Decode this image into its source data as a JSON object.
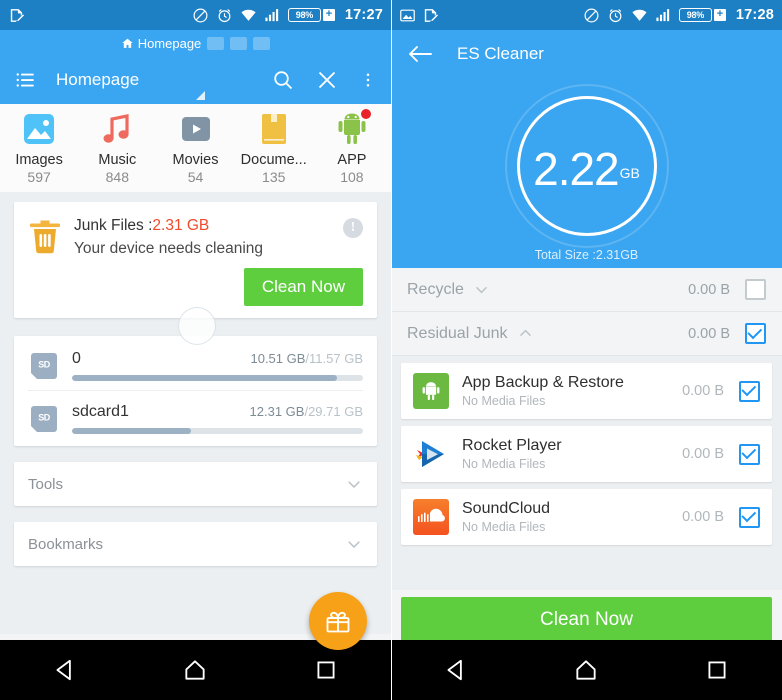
{
  "left": {
    "statusbar": {
      "icons": [
        "note-edit-icon",
        "no-disturb-icon",
        "alarm-icon",
        "wifi-icon",
        "signal-icon"
      ],
      "battery": "98%",
      "charging_symbol": "+",
      "time": "17:27"
    },
    "tabstrip": {
      "active_tab": "Homepage",
      "ghost_tabs": 3,
      "home_icon": "home-icon"
    },
    "appbar": {
      "menu_icon": "list-menu-icon",
      "title": "Homepage",
      "search_icon": "search-icon",
      "close_icon": "close-icon",
      "overflow_icon": "overflow-menu-icon"
    },
    "categories": [
      {
        "name": "Images",
        "count": "597",
        "icon": "image-icon",
        "color": "#4fc3f7"
      },
      {
        "name": "Music",
        "count": "848",
        "icon": "music-icon",
        "color": "#ef6a5e"
      },
      {
        "name": "Movies",
        "count": "54",
        "icon": "movie-icon",
        "color": "#8194a6"
      },
      {
        "name": "Docume...",
        "count": "135",
        "icon": "document-icon",
        "color": "#f0c042"
      },
      {
        "name": "APP",
        "count": "108",
        "icon": "android-icon",
        "color": "#8bc34a",
        "badge": true
      }
    ],
    "junk_card": {
      "icon": "trash-icon",
      "label": "Junk Files :",
      "size": "2.31 GB",
      "subtitle": "Your device needs cleaning",
      "info_icon": "info-icon",
      "button": "Clean Now",
      "button_color": "#5ece3f"
    },
    "storage": [
      {
        "icon": "sd-card-icon",
        "name": "0",
        "used": "10.51 GB",
        "total": "/11.57 GB",
        "percent": 91
      },
      {
        "icon": "sd-card-icon",
        "name": "sdcard1",
        "used": "12.31 GB",
        "total": "/29.71 GB",
        "percent": 41
      }
    ],
    "rows": [
      {
        "label": "Tools",
        "chevron": "chevron-down-icon"
      },
      {
        "label": "Bookmarks",
        "chevron": "chevron-down-icon"
      }
    ],
    "fab": {
      "icon": "gift-icon",
      "color": "#f6a117"
    }
  },
  "right": {
    "statusbar": {
      "icons": [
        "gallery-icon",
        "note-edit-icon",
        "no-disturb-icon",
        "alarm-icon",
        "wifi-icon",
        "signal-icon"
      ],
      "battery": "98%",
      "charging_symbol": "+",
      "time": "17:28"
    },
    "appbar": {
      "back_icon": "back-arrow-icon",
      "title": "ES Cleaner"
    },
    "gauge": {
      "value": "2.22",
      "unit": "GB",
      "caption": "Total Size :2.31GB"
    },
    "groups": [
      {
        "name": "Recycle",
        "chevron": "chevron-down-icon",
        "size": "0.00 B",
        "checked": false
      },
      {
        "name": "Residual Junk",
        "chevron": "chevron-up-icon",
        "size": "0.00 B",
        "checked": true
      }
    ],
    "apps": [
      {
        "name": "App Backup & Restore",
        "subtitle": "No Media Files",
        "size": "0.00 B",
        "checked": true,
        "icon": "android-app-icon",
        "color": "#6bb941"
      },
      {
        "name": "Rocket Player",
        "subtitle": "No Media Files",
        "size": "0.00 B",
        "checked": true,
        "icon": "rocket-player-icon",
        "color": "#1f7fd4"
      },
      {
        "name": "SoundCloud",
        "subtitle": "No Media Files",
        "size": "0.00 B",
        "checked": true,
        "icon": "soundcloud-icon",
        "color": "#f4521f"
      }
    ],
    "footer": {
      "button": "Clean Now",
      "button_color": "#5ece3f"
    }
  },
  "navbar": {
    "back": "back-triangle-icon",
    "home": "home-pentagon-icon",
    "recents": "recents-square-icon"
  }
}
